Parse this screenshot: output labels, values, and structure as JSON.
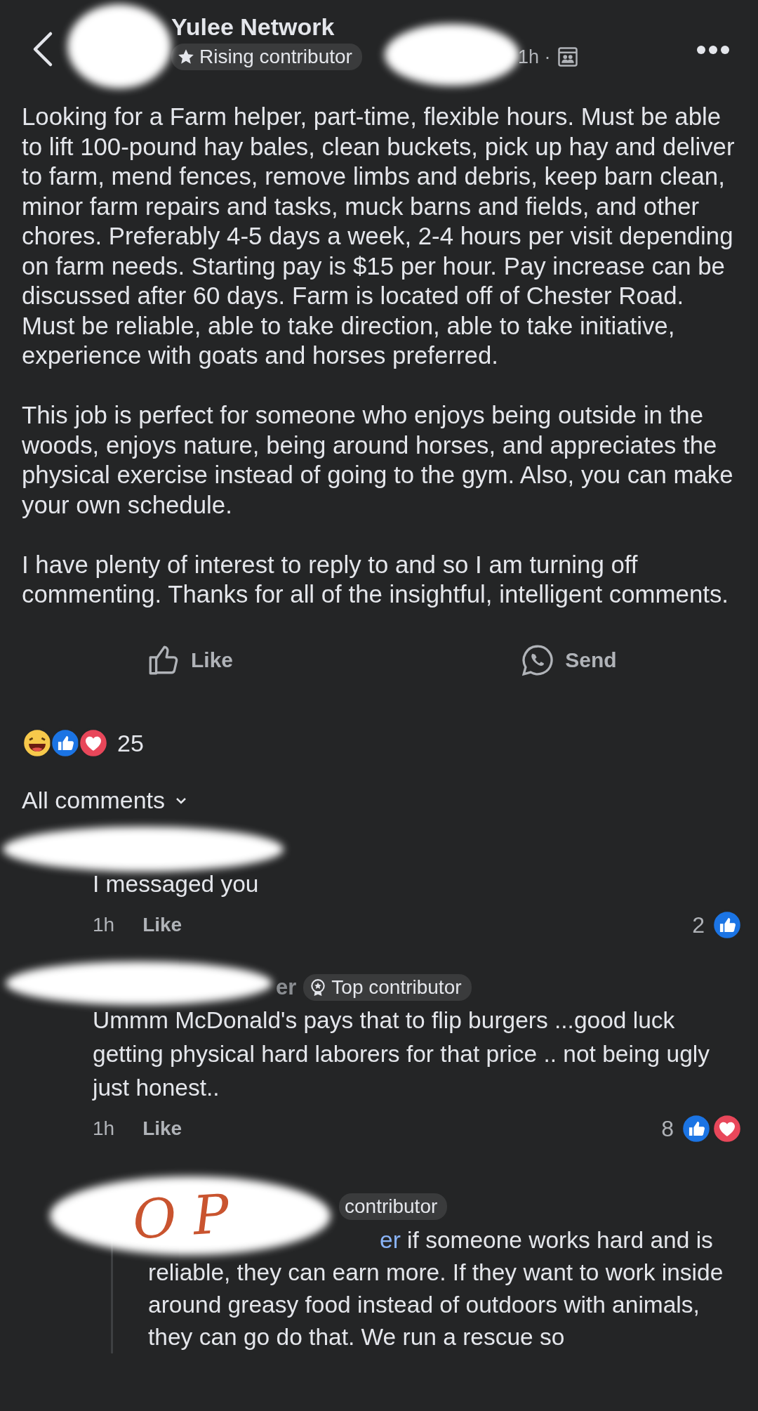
{
  "header": {
    "group": "Yulee Network",
    "badge": "Rising contributor",
    "time": "1h ·"
  },
  "post": {
    "paragraphs": [
      "Looking for a Farm helper, part-time, flexible hours. Must be able to lift 100-pound hay bales, clean buckets, pick up hay and deliver to farm, mend fences, remove limbs and debris, keep barn clean, minor farm repairs and tasks, muck barns and fields, and other chores. Preferably 4-5 days a week, 2-4 hours per visit depending on farm needs. Starting pay is $15 per hour. Pay increase can be discussed after 60 days. Farm is located off of Chester Road. Must be reliable, able to take direction, able to take initiative, experience with goats and horses preferred.",
      "This job is perfect for someone who enjoys being outside in the woods, enjoys nature, being around horses, and appreciates the physical exercise instead of going to the gym. Also, you can make your own schedule.",
      "I have plenty of interest to reply to and so I am turning off commenting. Thanks for all of the insightful, intelligent comments."
    ]
  },
  "actions": [
    {
      "kind": "like",
      "label": "Like"
    },
    {
      "kind": "send",
      "label": "Send"
    }
  ],
  "reactions": {
    "count": "25"
  },
  "comments_filter": "All comments",
  "comments": [
    {
      "text": "I messaged you",
      "time": "1h",
      "like_label": "Like",
      "reaction_count": "2",
      "loved": false
    },
    {
      "name_fragment": "er",
      "badge": "Top contributor",
      "text": "Ummm McDonald's pays that to flip burgers ...good luck getting physical hard laborers for that price .. not being ugly just honest..",
      "time": "1h",
      "like_label": "Like",
      "reaction_count": "8",
      "loved": true,
      "replies": [
        {
          "handwritten_note": "OP",
          "badge": "contributor",
          "name_fragment": "er",
          "first_line": "if someone works hard and is",
          "text": "reliable, they can earn more. If they want to work inside around greasy food instead of outdoors with animals, they can go do that. We run a rescue so"
        }
      ]
    }
  ]
}
